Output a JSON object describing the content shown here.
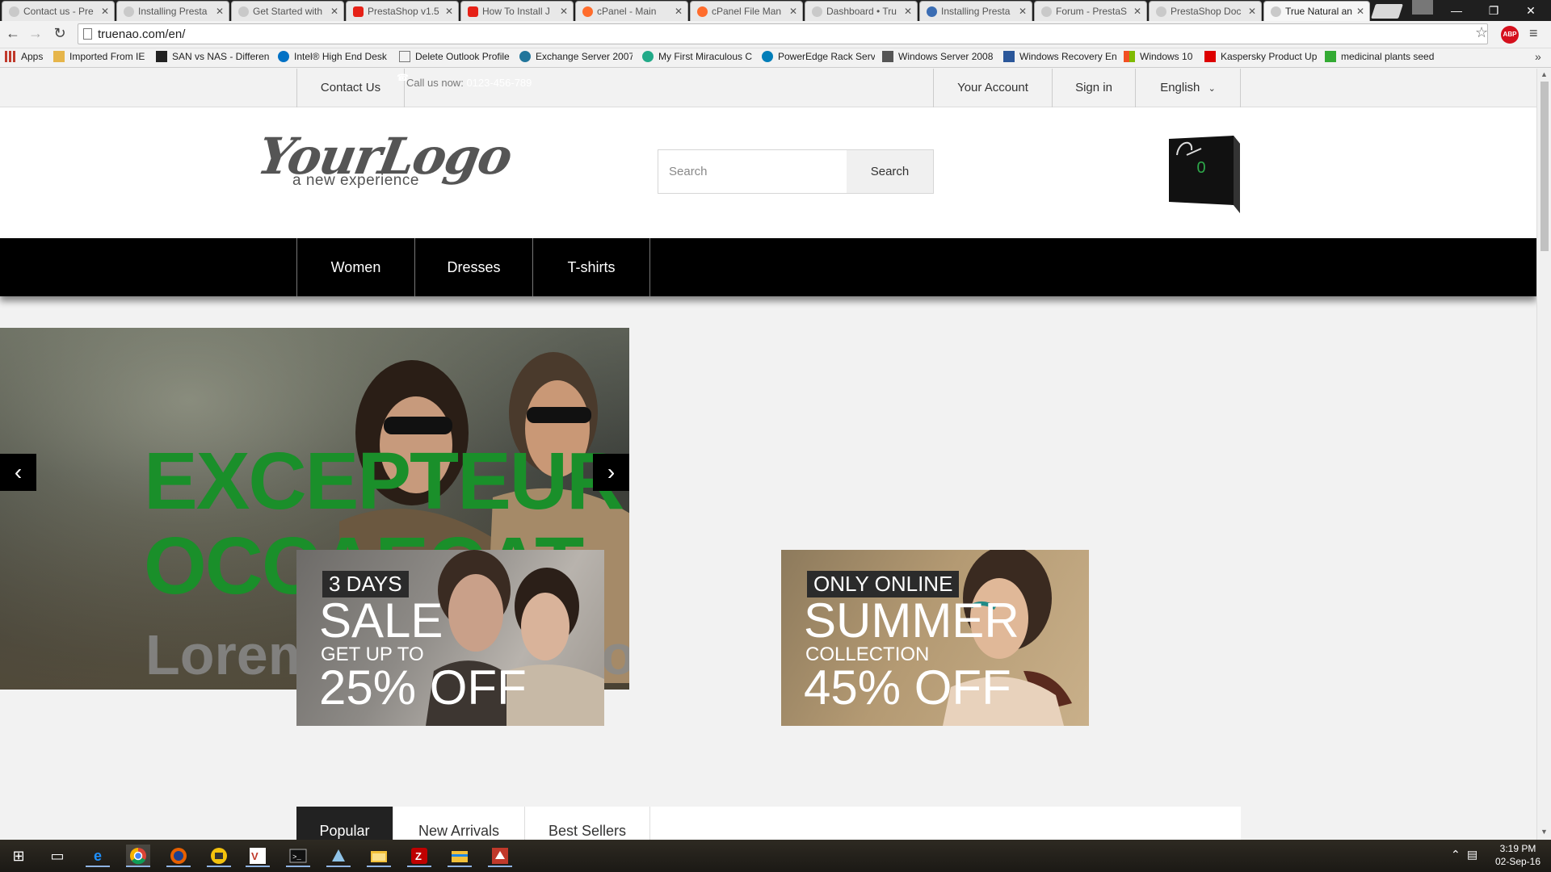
{
  "browser": {
    "tabs": [
      {
        "title": "Contact us - Pre",
        "active": false
      },
      {
        "title": "Installing Presta",
        "active": false
      },
      {
        "title": "Get Started with",
        "active": false
      },
      {
        "title": "PrestaShop v1.5",
        "active": false
      },
      {
        "title": "How To Install J",
        "active": false
      },
      {
        "title": "cPanel - Main",
        "active": false
      },
      {
        "title": "cPanel File Man",
        "active": false
      },
      {
        "title": "Dashboard • Tru",
        "active": false
      },
      {
        "title": "Installing Presta",
        "active": false
      },
      {
        "title": "Forum - PrestaS",
        "active": false
      },
      {
        "title": "PrestaShop Doc",
        "active": false
      },
      {
        "title": "True Natural an",
        "active": true
      }
    ],
    "url": "truenao.com/en/",
    "bookmarks": [
      {
        "label": "Apps",
        "icon": "apps-grid-icon"
      },
      {
        "label": "Imported From IE",
        "icon": "folder-icon"
      },
      {
        "label": "SAN vs NAS - Differen",
        "icon": "site-icon"
      },
      {
        "label": "Intel® High End Desk",
        "icon": "intel-icon"
      },
      {
        "label": "Delete Outlook Profile",
        "icon": "page-icon"
      },
      {
        "label": "Exchange Server 2007",
        "icon": "wordpress-icon"
      },
      {
        "label": "My First Miraculous C",
        "icon": "site-icon"
      },
      {
        "label": "PowerEdge Rack Serv",
        "icon": "dell-icon"
      },
      {
        "label": "Windows Server 2008",
        "icon": "site-icon"
      },
      {
        "label": "Windows Recovery En",
        "icon": "site-icon"
      },
      {
        "label": "Windows 10",
        "icon": "windows-icon"
      },
      {
        "label": "Kaspersky Product Up",
        "icon": "kaspersky-icon"
      },
      {
        "label": "medicinal plants seed",
        "icon": "site-icon"
      }
    ],
    "more_bookmarks": "»",
    "extension_label": "ABP"
  },
  "store": {
    "topbar": {
      "contact": "Contact Us",
      "call_label": "Call us now:",
      "call_number": "0123-456-789",
      "account": "Your Account",
      "signin": "Sign in",
      "language": "English"
    },
    "logo": {
      "main": "YourLogo",
      "sub": "a new experience"
    },
    "search": {
      "placeholder": "Search",
      "button": "Search"
    },
    "cart": {
      "count": "0"
    },
    "menu": [
      "Women",
      "Dresses",
      "T-shirts"
    ],
    "slider": {
      "title_line1": "EXCEPTEUR",
      "title_line2": "OCCAECAT",
      "subtitle": "Lorem ipsum dolor"
    },
    "banners": [
      {
        "tag": "3 DAYS",
        "big": "SALE",
        "mid": "GET UP TO",
        "pct": "25% OFF"
      },
      {
        "tag": "ONLY ONLINE",
        "big": "SUMMER",
        "mid": "COLLECTION",
        "pct": "45% OFF"
      }
    ],
    "product_tabs": [
      "Popular",
      "New Arrivals",
      "Best Sellers"
    ]
  },
  "taskbar": {
    "clock_time": "3:19 PM",
    "clock_date": "02-Sep-16"
  },
  "colors": {
    "accent_green": "#1a8f2a",
    "menu_bg": "#000000",
    "cart_count": "#2ea84a"
  }
}
